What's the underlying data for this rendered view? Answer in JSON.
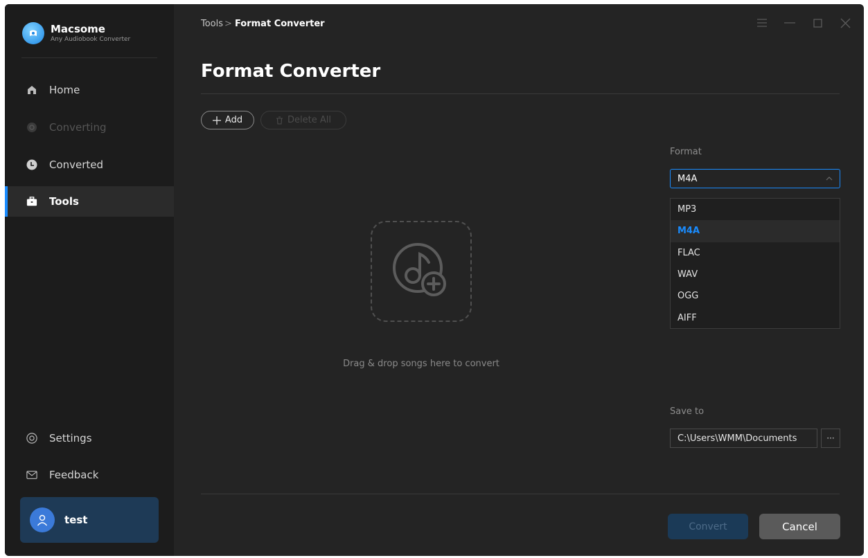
{
  "app": {
    "name": "Macsome",
    "subtitle": "Any Audiobook Converter"
  },
  "sidebar": {
    "items": [
      {
        "label": "Home",
        "icon": "home-icon",
        "state": "normal"
      },
      {
        "label": "Converting",
        "icon": "converting-icon",
        "state": "disabled"
      },
      {
        "label": "Converted",
        "icon": "clock-icon",
        "state": "normal"
      },
      {
        "label": "Tools",
        "icon": "toolbox-icon",
        "state": "active"
      }
    ],
    "bottom_items": [
      {
        "label": "Settings",
        "icon": "gear-icon"
      },
      {
        "label": "Feedback",
        "icon": "mail-icon"
      }
    ],
    "user": {
      "name": "test",
      "icon": "user-icon"
    }
  },
  "breadcrumb": {
    "parent": "Tools",
    "separator": ">",
    "current": "Format Converter"
  },
  "page": {
    "title": "Format Converter"
  },
  "toolbar": {
    "add_label": "Add",
    "delete_all_label": "Delete All"
  },
  "drop_zone": {
    "text": "Drag & drop songs here to convert"
  },
  "format": {
    "label": "Format",
    "selected": "M4A",
    "options": [
      "MP3",
      "M4A",
      "FLAC",
      "WAV",
      "OGG",
      "AIFF"
    ]
  },
  "save_to": {
    "label": "Save to",
    "path": "C:\\Users\\WMM\\Documents",
    "browse_label": "···"
  },
  "actions": {
    "convert_label": "Convert",
    "cancel_label": "Cancel"
  },
  "colors": {
    "accent": "#1a8cff",
    "background": "#242424",
    "sidebar": "#1c1c1c"
  }
}
